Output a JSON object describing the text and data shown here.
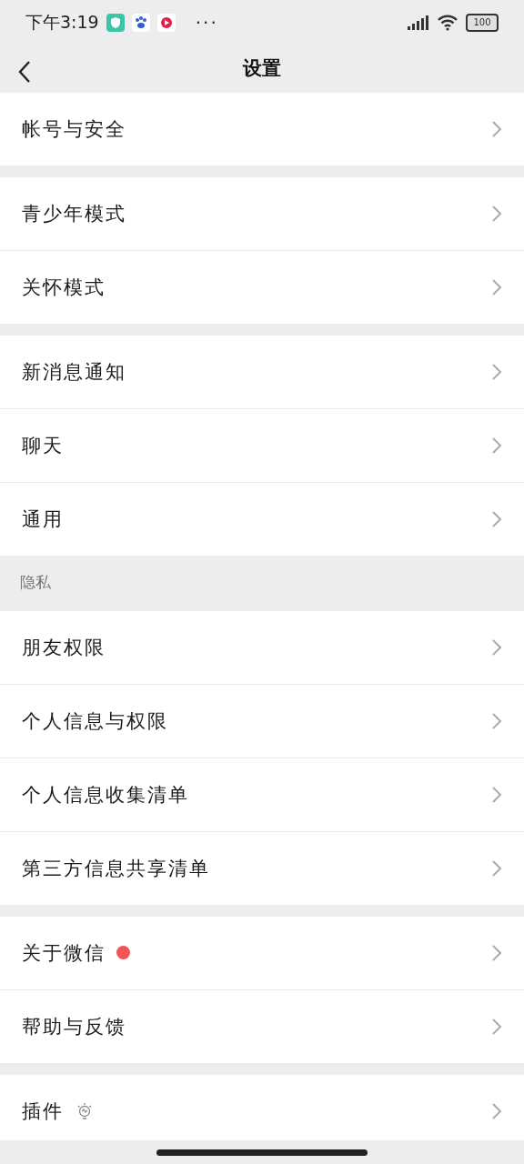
{
  "status_bar": {
    "time": "下午3:19",
    "more": "···",
    "battery": "100"
  },
  "nav": {
    "title": "设置"
  },
  "groups": [
    {
      "items": [
        {
          "label": "帐号与安全",
          "kind": "plain"
        }
      ]
    },
    {
      "items": [
        {
          "label": "青少年模式",
          "kind": "plain"
        },
        {
          "label": "关怀模式",
          "kind": "plain"
        }
      ]
    },
    {
      "items": [
        {
          "label": "新消息通知",
          "kind": "plain"
        },
        {
          "label": "聊天",
          "kind": "plain"
        },
        {
          "label": "通用",
          "kind": "plain"
        }
      ]
    },
    {
      "header": "隐私",
      "items": [
        {
          "label": "朋友权限",
          "kind": "plain"
        },
        {
          "label": "个人信息与权限",
          "kind": "plain"
        },
        {
          "label": "个人信息收集清单",
          "kind": "plain"
        },
        {
          "label": "第三方信息共享清单",
          "kind": "plain"
        }
      ]
    },
    {
      "items": [
        {
          "label": "关于微信",
          "kind": "dot",
          "color": "#f05454"
        },
        {
          "label": "帮助与反馈",
          "kind": "plain"
        }
      ]
    },
    {
      "items": [
        {
          "label": "插件",
          "kind": "bulb"
        }
      ]
    }
  ]
}
